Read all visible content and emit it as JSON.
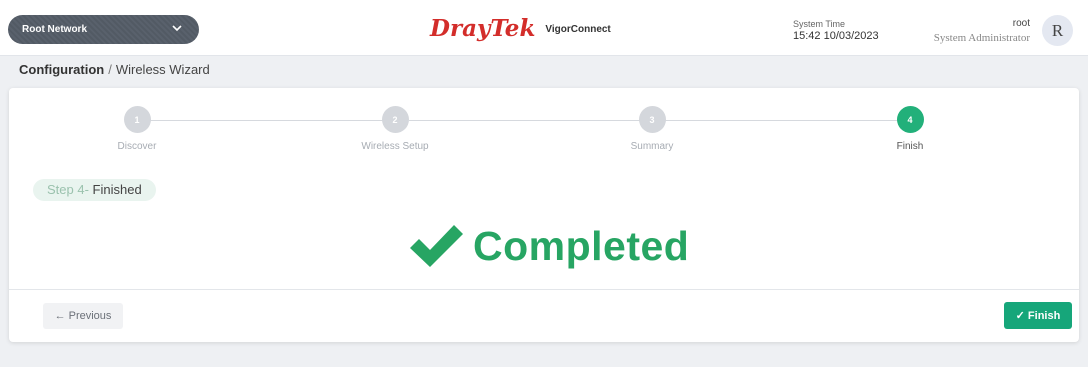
{
  "header": {
    "network_select": "Root Network",
    "brand": "DrayTek",
    "app_name": "VigorConnect",
    "system_time_label": "System Time",
    "system_time_value": "15:42 10/03/2023",
    "user_name": "root",
    "user_role": "System Administrator",
    "avatar_initial": "R"
  },
  "breadcrumb": {
    "root": "Configuration",
    "separator": "/",
    "current": "Wireless Wizard"
  },
  "wizard": {
    "steps": [
      {
        "number": "1",
        "label": "Discover"
      },
      {
        "number": "2",
        "label": "Wireless Setup"
      },
      {
        "number": "3",
        "label": "Summary"
      },
      {
        "number": "4",
        "label": "Finish"
      }
    ],
    "active_step": 4,
    "step_badge_prefix": "Step 4-",
    "step_badge_text": " Finished",
    "completed_text": "Completed"
  },
  "footer": {
    "previous_label": "← Previous",
    "finish_label": "✓ Finish"
  },
  "colors": {
    "accent_green": "#22b07a",
    "completed_green": "#27a563",
    "finish_button": "#16a67a",
    "brand_red": "#d32d2a"
  },
  "icons": {
    "network_chevron": "chevron-down-icon",
    "completed_check": "check-icon"
  }
}
